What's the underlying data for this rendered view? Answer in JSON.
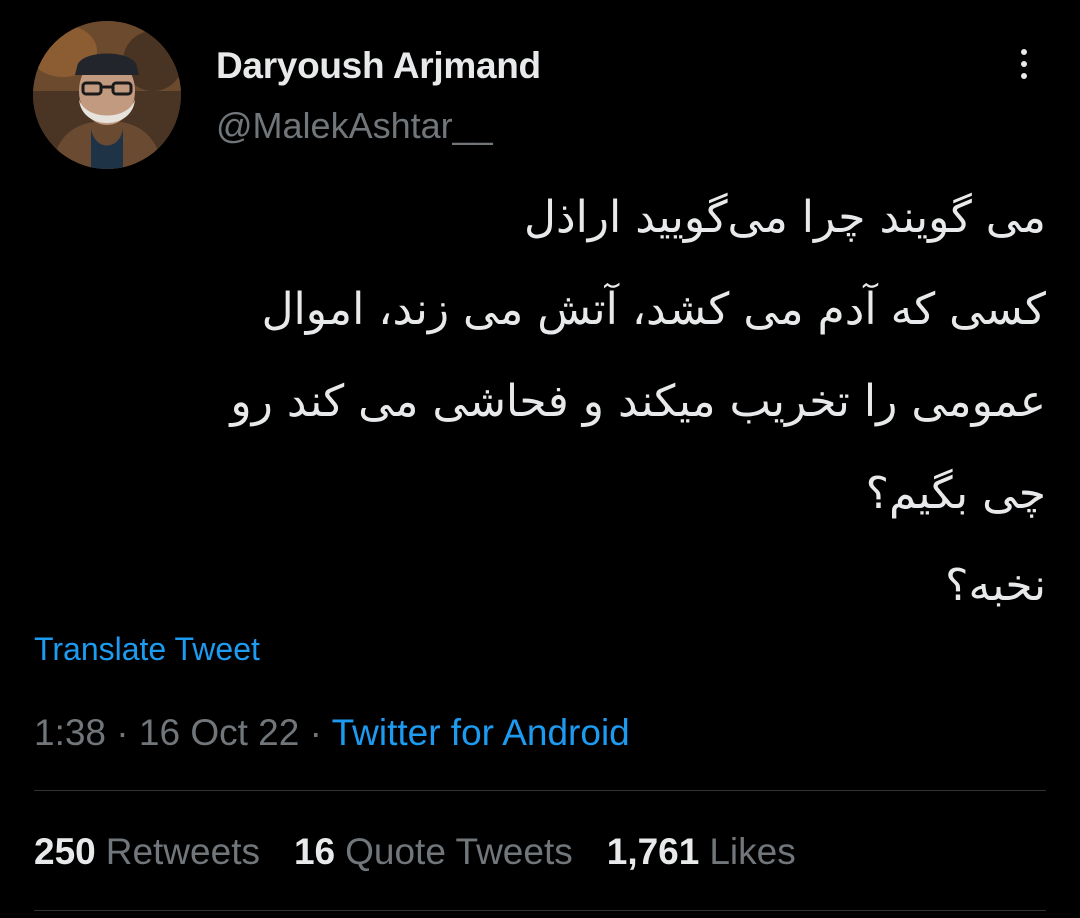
{
  "author": {
    "display_name": "Daryoush Arjmand",
    "handle": "@MalekAshtar__"
  },
  "tweet": {
    "lines": [
      "می گویند چرا می‌گویید اراذل",
      "کسی که آدم می کشد، آتش می زند، اموال",
      "عمومی را تخریب میکند و فحاشی می کند رو",
      "چی بگیم؟",
      "نخبه؟"
    ],
    "translate_label": "Translate Tweet"
  },
  "meta": {
    "time": "1:38",
    "separator": "·",
    "date": "16 Oct 22",
    "source": "Twitter for Android"
  },
  "stats": {
    "retweets": {
      "count": "250",
      "label": "Retweets"
    },
    "quote_tweets": {
      "count": "16",
      "label": "Quote Tweets"
    },
    "likes": {
      "count": "1,761",
      "label": "Likes"
    }
  },
  "colors": {
    "background": "#000000",
    "primary_text": "#e7e9ea",
    "secondary_text": "#71767b",
    "link": "#1d9bf0",
    "divider": "#2f3336"
  },
  "icons": {
    "more": "more-vertical-icon"
  }
}
